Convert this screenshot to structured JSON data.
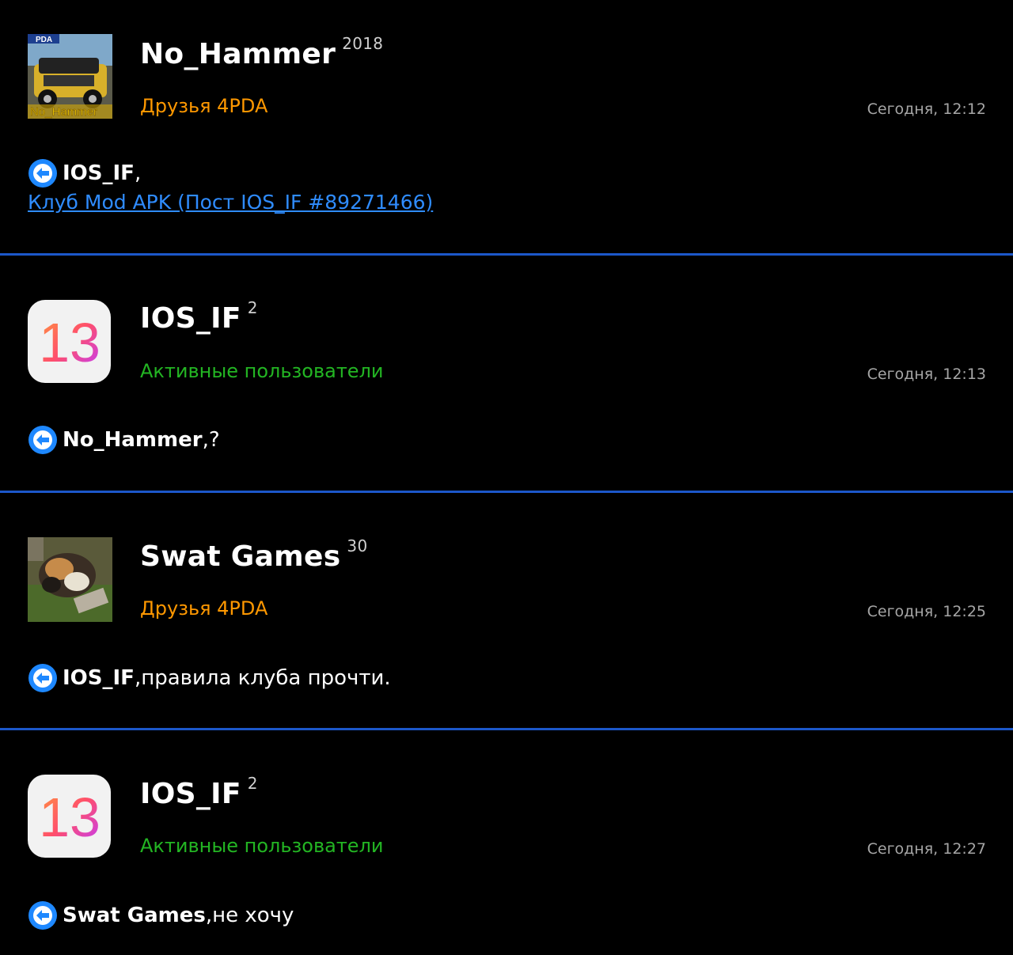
{
  "posts": [
    {
      "author": "No_Hammer",
      "reputation": "2018",
      "group": "Друзья 4PDA",
      "time": "Сегодня, 12:12",
      "reply_to": "IOS_IF",
      "reply_sep": ",",
      "reply_text": "",
      "link": "Клуб Mod APK (Пост IOS_IF #89271466)",
      "avatar_text": [
        "PDA",
        "No_Hammer"
      ]
    },
    {
      "author": "IOS_IF",
      "reputation": "2",
      "group": "Активные пользователи",
      "time": "Сегодня, 12:13",
      "reply_to": "No_Hammer",
      "reply_sep": ",",
      "reply_text": " ?",
      "avatar_text": "13"
    },
    {
      "author": "Swat Games",
      "reputation": "30",
      "group": "Друзья 4PDA",
      "time": "Сегодня, 12:25",
      "reply_to": "IOS_IF",
      "reply_sep": ",",
      "reply_text": " правила клуба прочти."
    },
    {
      "author": "IOS_IF",
      "reputation": "2",
      "group": "Активные пользователи",
      "time": "Сегодня, 12:27",
      "reply_to": "Swat Games",
      "reply_sep": ",",
      "reply_text": " не хочу",
      "avatar_text": "13"
    }
  ],
  "colors": {
    "background": "#000000",
    "divider": "#1c57c9",
    "friends_group": "#ff9800",
    "active_group": "#23b523",
    "link": "#2f8cff",
    "reply_icon": "#1e88ff"
  },
  "icons": [
    "reply-arrow-icon"
  ]
}
